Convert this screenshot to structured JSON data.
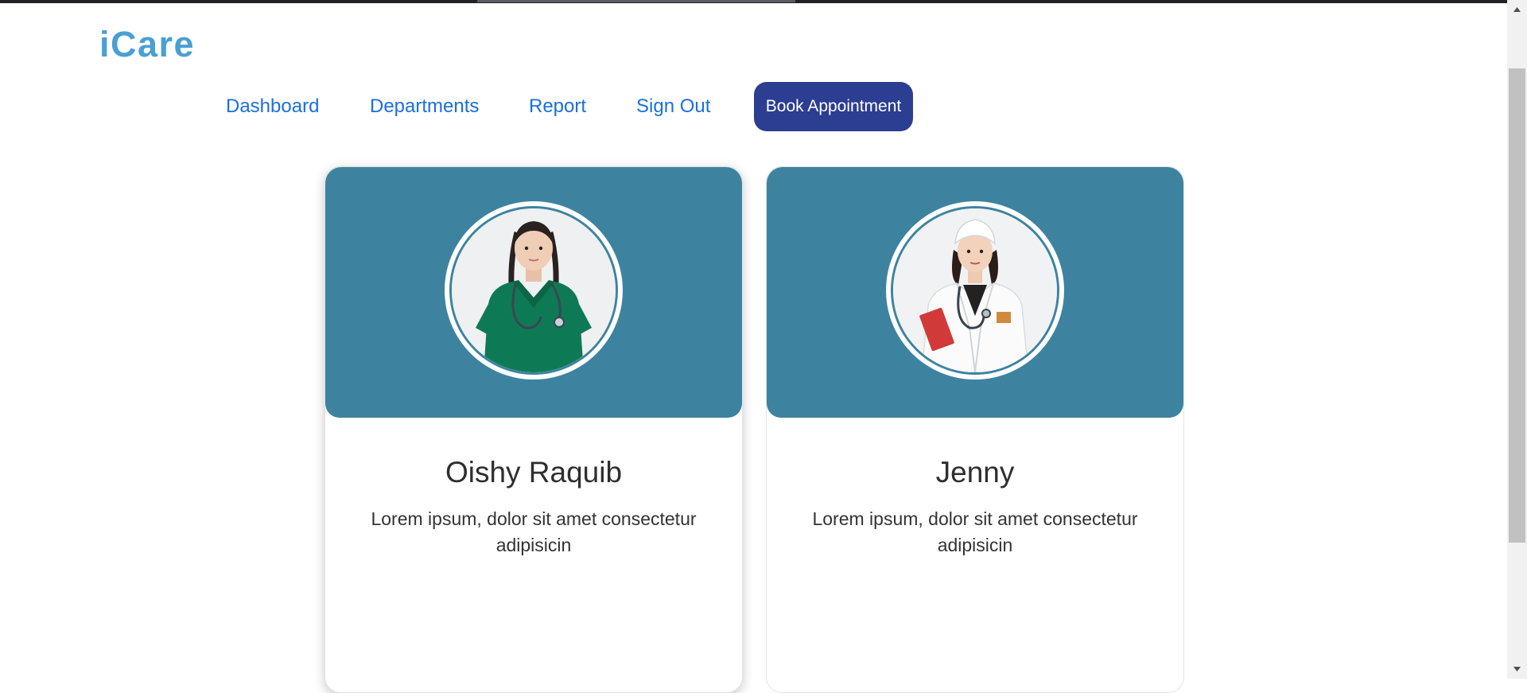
{
  "brand": {
    "name": "iCare",
    "color": "#4a9fd3"
  },
  "nav": {
    "items": [
      {
        "label": "Dashboard"
      },
      {
        "label": "Departments"
      },
      {
        "label": "Report"
      },
      {
        "label": "Sign Out"
      }
    ],
    "cta_label": "Book Appointment",
    "link_color": "#1a6fe0",
    "cta_color": "#2c3e92"
  },
  "doctors": [
    {
      "name": "Oishy Raquib",
      "description": "Lorem ipsum, dolor sit amet consectetur adipisicin",
      "photo_icon": "doctor-green-scrubs-photo"
    },
    {
      "name": "Jenny",
      "description": "Lorem ipsum, dolor sit amet consectetur adipisicin",
      "photo_icon": "doctor-white-coat-photo"
    }
  ],
  "colors": {
    "card_header": "#3d83a0"
  }
}
